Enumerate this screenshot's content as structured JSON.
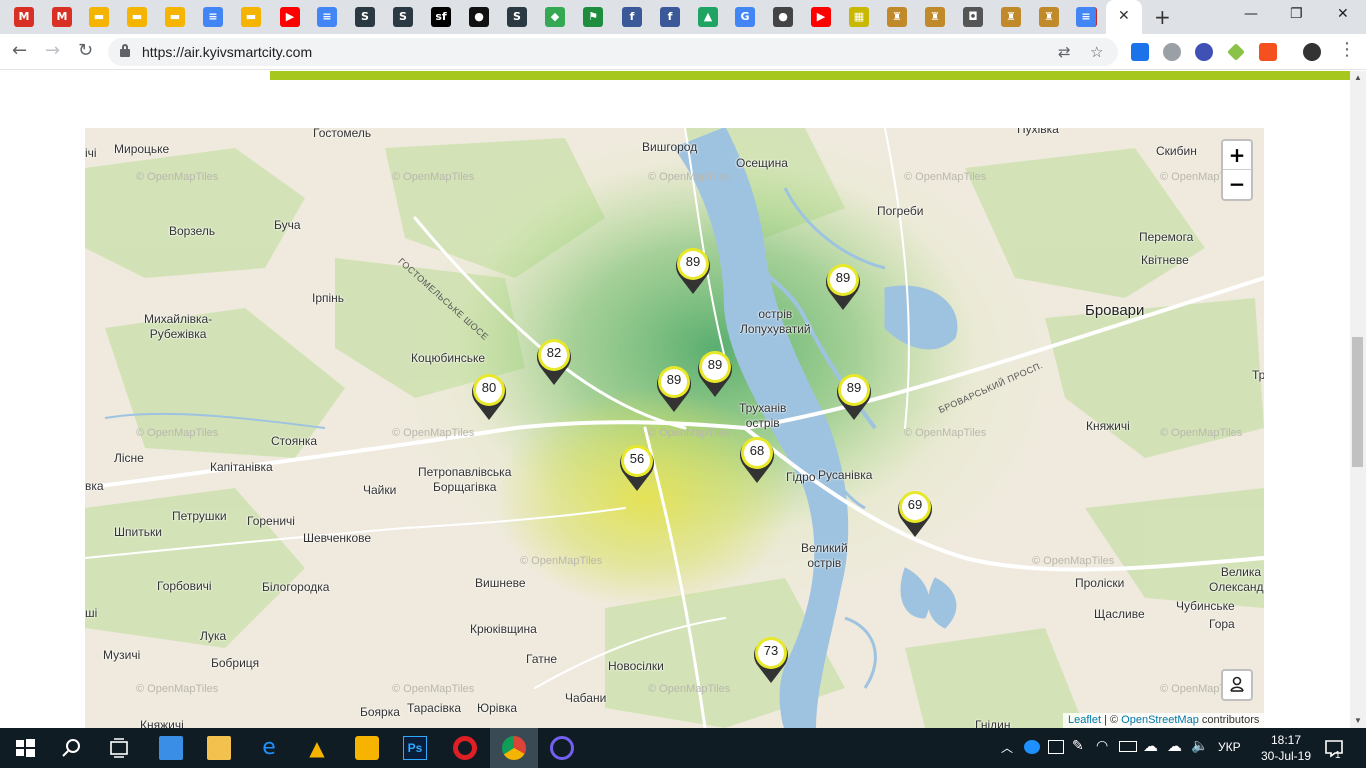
{
  "browser": {
    "tabs": [
      {
        "icon": "gmail-icon",
        "color": "#d93025",
        "glyph": "M"
      },
      {
        "icon": "gmail-icon",
        "color": "#d93025",
        "glyph": "M"
      },
      {
        "icon": "slides-icon",
        "color": "#f4b400",
        "glyph": "▬"
      },
      {
        "icon": "slides-icon",
        "color": "#f4b400",
        "glyph": "▬"
      },
      {
        "icon": "slides-icon",
        "color": "#f4b400",
        "glyph": "▬"
      },
      {
        "icon": "docs-icon",
        "color": "#4285f4",
        "glyph": "≡"
      },
      {
        "icon": "slides-icon",
        "color": "#f4b400",
        "glyph": "▬"
      },
      {
        "icon": "youtube-icon",
        "color": "#ff0000",
        "glyph": "▶"
      },
      {
        "icon": "docs-icon",
        "color": "#4285f4",
        "glyph": "≡"
      },
      {
        "icon": "s-logo-icon",
        "color": "#2b3a42",
        "glyph": "S"
      },
      {
        "icon": "s-logo-icon",
        "color": "#2b3a42",
        "glyph": "S"
      },
      {
        "icon": "symfony-icon",
        "color": "#000000",
        "glyph": "sf"
      },
      {
        "icon": "github-icon",
        "color": "#111111",
        "glyph": "●"
      },
      {
        "icon": "s-logo-icon",
        "color": "#2b3a42",
        "glyph": "S"
      },
      {
        "icon": "maps-icon",
        "color": "#34a853",
        "glyph": "◆"
      },
      {
        "icon": "flag-icon",
        "color": "#1e8e3e",
        "glyph": "⚑"
      },
      {
        "icon": "facebook-icon",
        "color": "#3b5998",
        "glyph": "f"
      },
      {
        "icon": "facebook-icon",
        "color": "#3b5998",
        "glyph": "f"
      },
      {
        "icon": "drive-icon",
        "color": "#1fa463",
        "glyph": "▲"
      },
      {
        "icon": "google-icon",
        "color": "#4285f4",
        "glyph": "G"
      },
      {
        "icon": "panda-icon",
        "color": "#444444",
        "glyph": "●"
      },
      {
        "icon": "youtube-icon",
        "color": "#ff0000",
        "glyph": "▶"
      },
      {
        "icon": "yellow-grid-icon",
        "color": "#c9b800",
        "glyph": "▦"
      },
      {
        "icon": "kyiv-emblem-icon",
        "color": "#c08a2a",
        "glyph": "♜"
      },
      {
        "icon": "kyiv-emblem-icon",
        "color": "#c08a2a",
        "glyph": "♜"
      },
      {
        "icon": "robot-icon",
        "color": "#555555",
        "glyph": "◘"
      },
      {
        "icon": "kyiv-emblem-icon",
        "color": "#c08a2a",
        "glyph": "♜"
      },
      {
        "icon": "kyiv-emblem-icon",
        "color": "#c08a2a",
        "glyph": "♜"
      },
      {
        "icon": "v-logo-icon",
        "color": "#c62828",
        "glyph": "V"
      },
      {
        "icon": "docs-icon",
        "color": "#4285f4",
        "glyph": "≡"
      }
    ],
    "active_tab_close": "✕",
    "new_tab": "+",
    "window_controls": {
      "minimize": "—",
      "restore": "❐",
      "close": "✕"
    },
    "url": "https://air.kyivsmartcity.com"
  },
  "map": {
    "places": [
      {
        "name": "Гостомель",
        "big": false
      },
      {
        "name": "Мироцьке",
        "big": false
      },
      {
        "name": "Вишгород",
        "big": false
      },
      {
        "name": "Осещина",
        "big": false
      },
      {
        "name": "Пухівка",
        "big": false
      },
      {
        "name": "Скибин",
        "big": false
      },
      {
        "name": "Буча",
        "big": false
      },
      {
        "name": "Ворзель",
        "big": false
      },
      {
        "name": "Погреби",
        "big": false
      },
      {
        "name": "Перемога",
        "big": false
      },
      {
        "name": "Квітневе",
        "big": false
      },
      {
        "name": "Ірпінь",
        "big": false
      },
      {
        "name": "Михайлівка-\nРубежівка",
        "big": false
      },
      {
        "name": "острів\nЛопухуватий",
        "big": false
      },
      {
        "name": "Бровари",
        "big": true
      },
      {
        "name": "Коцюбинське",
        "big": false
      },
      {
        "name": "Труханів\nострів",
        "big": false
      },
      {
        "name": "Стоянка",
        "big": false
      },
      {
        "name": "Княжичі",
        "big": false
      },
      {
        "name": "Лісне",
        "big": false
      },
      {
        "name": "Капітанівка",
        "big": false
      },
      {
        "name": "Петропавлівська\nБорщагівка",
        "big": false
      },
      {
        "name": "Гідро",
        "big": false
      },
      {
        "name": "Русанівка",
        "big": false
      },
      {
        "name": "Чайки",
        "big": false
      },
      {
        "name": "Петрушки",
        "big": false
      },
      {
        "name": "Шпитьки",
        "big": false
      },
      {
        "name": "Гореничі",
        "big": false
      },
      {
        "name": "Шевченкове",
        "big": false
      },
      {
        "name": "Великий\nострів",
        "big": false
      },
      {
        "name": "Горбовичі",
        "big": false
      },
      {
        "name": "Білогородка",
        "big": false
      },
      {
        "name": "Вишневе",
        "big": false
      },
      {
        "name": "Проліски",
        "big": false
      },
      {
        "name": "Велика\nОлександрі",
        "big": false
      },
      {
        "name": "Чубинське",
        "big": false
      },
      {
        "name": "Щасливе",
        "big": false
      },
      {
        "name": "Гора",
        "big": false
      },
      {
        "name": "Лука",
        "big": false
      },
      {
        "name": "Крюківщина",
        "big": false
      },
      {
        "name": "Музичі",
        "big": false
      },
      {
        "name": "Бобриця",
        "big": false
      },
      {
        "name": "Гатне",
        "big": false
      },
      {
        "name": "Новосілки",
        "big": false
      },
      {
        "name": "Чабани",
        "big": false
      },
      {
        "name": "Тарасівка",
        "big": false
      },
      {
        "name": "Юрівка",
        "big": false
      },
      {
        "name": "Боярка",
        "big": false
      },
      {
        "name": "Княжичі",
        "big": false
      },
      {
        "name": "Гнідин",
        "big": false
      },
      {
        "name": "Тр",
        "big": false
      },
      {
        "name": "ічі",
        "big": false
      },
      {
        "name": "вка",
        "big": false
      },
      {
        "name": "ші",
        "big": false
      }
    ],
    "roads": [
      "ГОСТОМЕЛЬСЬКЕ ШОСЕ",
      "БРОВАРСЬКИЙ ПРОСП."
    ],
    "watermark": "© OpenMapTiles",
    "markers": [
      {
        "value": "89"
      },
      {
        "value": "89"
      },
      {
        "value": "82"
      },
      {
        "value": "89"
      },
      {
        "value": "89"
      },
      {
        "value": "80"
      },
      {
        "value": "89"
      },
      {
        "value": "56"
      },
      {
        "value": "68"
      },
      {
        "value": "69"
      },
      {
        "value": "73"
      }
    ],
    "zoom_in": "+",
    "zoom_out": "−",
    "attribution": {
      "leaflet": "Leaflet",
      "sep": " | © ",
      "osm": "OpenStreetMap",
      "suffix": " contributors"
    }
  },
  "taskbar": {
    "language": "УКР",
    "time": "18:17",
    "date": "30-Jul-19",
    "notification_count": "1"
  }
}
